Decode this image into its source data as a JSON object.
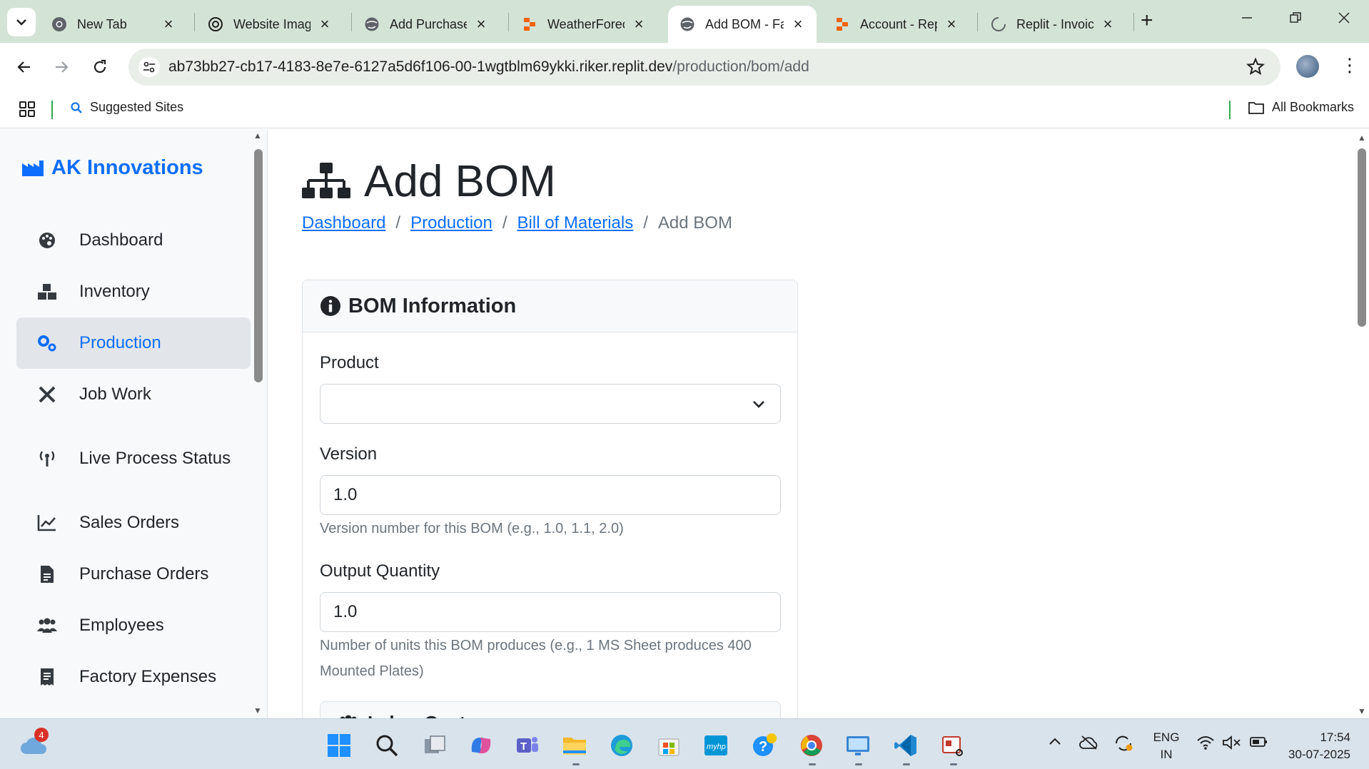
{
  "browser": {
    "tabs": [
      {
        "title": "New Tab",
        "icon": "chrome-icon",
        "active": false
      },
      {
        "title": "Website Imag",
        "icon": "openai-icon",
        "active": false
      },
      {
        "title": "Add Purchase",
        "icon": "globe-icon",
        "active": false
      },
      {
        "title": "WeatherForec",
        "icon": "replit-icon",
        "active": false
      },
      {
        "title": "Add BOM - Fa",
        "icon": "globe-icon",
        "active": true
      },
      {
        "title": "Account - Rep",
        "icon": "replit-icon",
        "active": false
      },
      {
        "title": "Replit - Invoic",
        "icon": "loading-icon",
        "active": false
      }
    ],
    "url_host": "ab73bb27-cb17-4183-8e7e-6127a5d6f106-00-1wgtblm69ykki.riker.replit.dev",
    "url_path": "/production/bom/add",
    "bookmarks": {
      "suggested": "Suggested Sites",
      "all": "All Bookmarks"
    }
  },
  "sidebar": {
    "brand": "AK Innovations",
    "items": [
      {
        "label": "Dashboard",
        "icon": "palette-icon",
        "active": false
      },
      {
        "label": "Inventory",
        "icon": "boxes-icon",
        "active": false
      },
      {
        "label": "Production",
        "icon": "cogs-icon",
        "active": true
      },
      {
        "label": "Job Work",
        "icon": "tools-icon",
        "active": false
      },
      {
        "label": "Live Process Status",
        "icon": "broadcast-icon",
        "active": false
      },
      {
        "label": "Sales Orders",
        "icon": "chart-line-icon",
        "active": false
      },
      {
        "label": "Purchase Orders",
        "icon": "file-icon",
        "active": false
      },
      {
        "label": "Employees",
        "icon": "users-icon",
        "active": false
      },
      {
        "label": "Factory Expenses",
        "icon": "receipt-icon",
        "active": false
      }
    ]
  },
  "page": {
    "title": "Add BOM",
    "breadcrumb": {
      "dashboard": "Dashboard",
      "production": "Production",
      "bom": "Bill of Materials",
      "current": "Add BOM",
      "separator": "/"
    },
    "card": {
      "header": "BOM Information",
      "product_label": "Product",
      "product_value": "",
      "version_label": "Version",
      "version_value": "1.0",
      "version_help": "Version number for this BOM (e.g., 1.0, 1.1, 2.0)",
      "output_label": "Output Quantity",
      "output_value": "1.0",
      "output_help": "Number of units this BOM produces (e.g., 1 MS Sheet produces 400 Mounted Plates)",
      "labor_header": "Labor Costs"
    }
  },
  "taskbar": {
    "weather_badge": "4",
    "lang_top": "ENG",
    "lang_bottom": "IN",
    "time": "17:54",
    "date": "30-07-2025"
  },
  "colors": {
    "primary": "#0d6efd",
    "chrome_frame": "#d3e3d6",
    "sidebar_bg": "#f8f9fa",
    "active_item_bg": "#e2e6ea"
  }
}
